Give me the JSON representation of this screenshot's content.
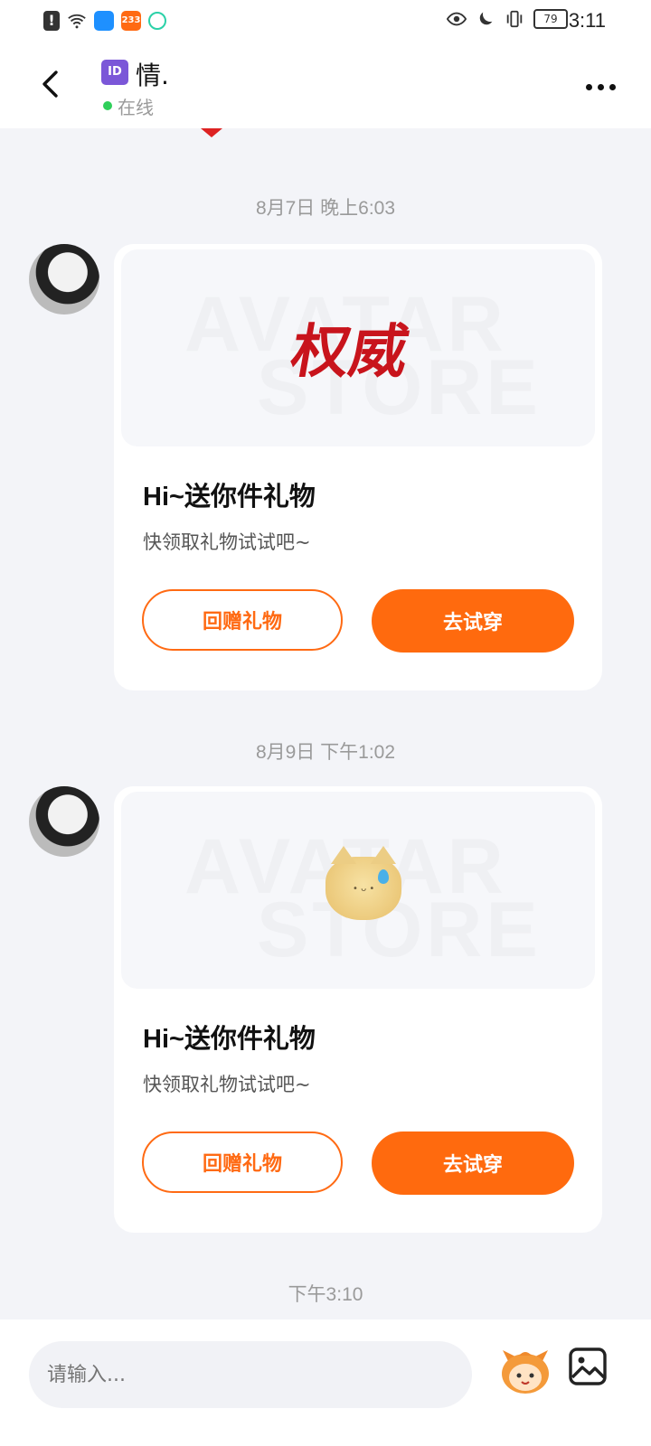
{
  "status_bar": {
    "time": "3:11",
    "battery": "79",
    "app_badge": "233",
    "icons": [
      "alert-icon",
      "wifi-icon",
      "weather-app-icon",
      "app-233-icon",
      "app-icon",
      "eye-icon",
      "moon-icon",
      "vibrate-icon",
      "battery-icon"
    ]
  },
  "header": {
    "badge": "ID",
    "name": "情.",
    "status": "在线",
    "status_color": "#2fcf5a"
  },
  "messages": [
    {
      "timestamp": "8月7日 晚上6:03",
      "watermark_top": "AVATAR",
      "watermark_bottom": "STORE",
      "item_text": "权威",
      "title": "Hi~送你件礼物",
      "subtitle": "快领取礼物试试吧~",
      "return_gift_label": "回赠礼物",
      "try_on_label": "去试穿"
    },
    {
      "timestamp": "8月9日 下午1:02",
      "watermark_top": "AVATAR",
      "watermark_bottom": "STORE",
      "item_text": "",
      "title": "Hi~送你件礼物",
      "subtitle": "快领取礼物试试吧~",
      "return_gift_label": "回赠礼物",
      "try_on_label": "去试穿"
    }
  ],
  "last_timestamp": "下午3:10",
  "composer": {
    "placeholder": "请输入..."
  },
  "colors": {
    "accent": "#ff6a13",
    "background": "#f3f4f8",
    "item_red": "#c8141c"
  }
}
